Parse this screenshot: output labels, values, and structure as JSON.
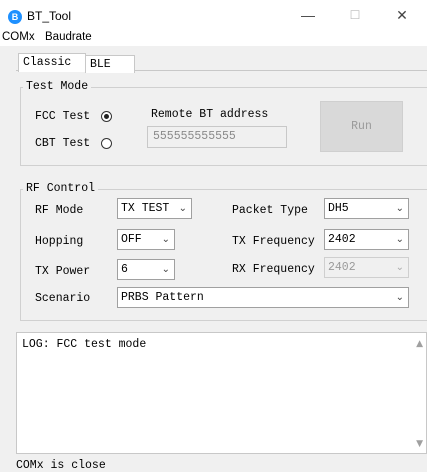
{
  "window": {
    "title": "BT_Tool",
    "minimize": "—",
    "maximize": "☐",
    "close": "✕"
  },
  "menu": {
    "items": [
      "COMx",
      "Baudrate"
    ]
  },
  "tabs": [
    {
      "label": "Classic",
      "active": true
    },
    {
      "label": "BLE",
      "active": false
    }
  ],
  "test_mode": {
    "legend": "Test Mode",
    "fcc_label": "FCC Test",
    "fcc_checked": true,
    "cbt_label": "CBT Test",
    "cbt_checked": false,
    "remote_label": "Remote BT address",
    "remote_value": "555555555555",
    "run_label": "Run"
  },
  "rf_control": {
    "legend": "RF Control",
    "rf_mode_label": "RF Mode",
    "rf_mode_value": "TX TEST",
    "hopping_label": "Hopping",
    "hopping_value": "OFF",
    "tx_power_label": "TX Power",
    "tx_power_value": "6",
    "scenario_label": "Scenario",
    "scenario_value": "PRBS Pattern",
    "packet_type_label": "Packet Type",
    "packet_type_value": "DH5",
    "tx_freq_label": "TX Frequency",
    "tx_freq_value": "2402",
    "rx_freq_label": "RX Frequency",
    "rx_freq_value": "2402"
  },
  "log": {
    "text": "LOG: FCC test mode"
  },
  "status": {
    "text": "COMx is close"
  },
  "icons": {
    "app": "bluetooth-app-icon",
    "dropdown": "chevron-down-icon"
  }
}
